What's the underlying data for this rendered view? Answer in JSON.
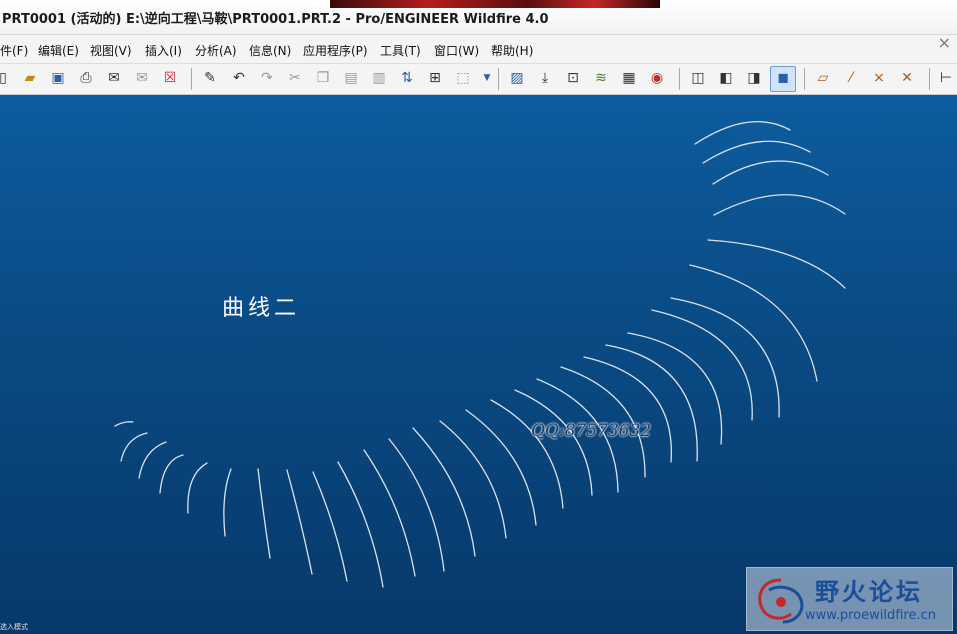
{
  "window": {
    "title": "PRT0001 (活动的) E:\\逆向工程\\马鞍\\PRT0001.PRT.2 - Pro/ENGINEER Wildfire 4.0"
  },
  "menu": [
    {
      "label": "件(F)"
    },
    {
      "label": "编辑(E)"
    },
    {
      "label": "视图(V)"
    },
    {
      "label": "插入(I)"
    },
    {
      "label": "分析(A)"
    },
    {
      "label": "信息(N)"
    },
    {
      "label": "应用程序(P)"
    },
    {
      "label": "工具(T)"
    },
    {
      "label": "窗口(W)"
    },
    {
      "label": "帮助(H)"
    }
  ],
  "toolbar": {
    "icons": [
      "new-icon",
      "open-icon",
      "save-icon",
      "print-icon",
      "send-mail-icon",
      "send-mail-attach-icon",
      "close-window-icon",
      "regenerate-icon",
      "undo-icon",
      "redo-icon",
      "cut-icon",
      "copy-icon",
      "paste-icon",
      "paste-special-icon",
      "model-tree-icon",
      "find-icon",
      "select-box-icon",
      "dropdown-icon",
      "repaint-icon",
      "reorient-icon",
      "saved-views-icon",
      "layers-icon",
      "view-manager-icon",
      "appearance-icon",
      "wireframe-icon",
      "hidden-line-icon",
      "no-hidden-icon",
      "shading-icon",
      "datum-planes-icon",
      "datum-axes-icon",
      "datum-points-icon",
      "csys-icon",
      "measure-icon"
    ],
    "active_icon": "shading-icon"
  },
  "canvas": {
    "curve_label": "曲线二",
    "qq_text": "QQ:87573632",
    "status_text": "选入模式"
  },
  "watermark": {
    "title": "野火论坛",
    "url": "www.proewildfire.cn"
  }
}
